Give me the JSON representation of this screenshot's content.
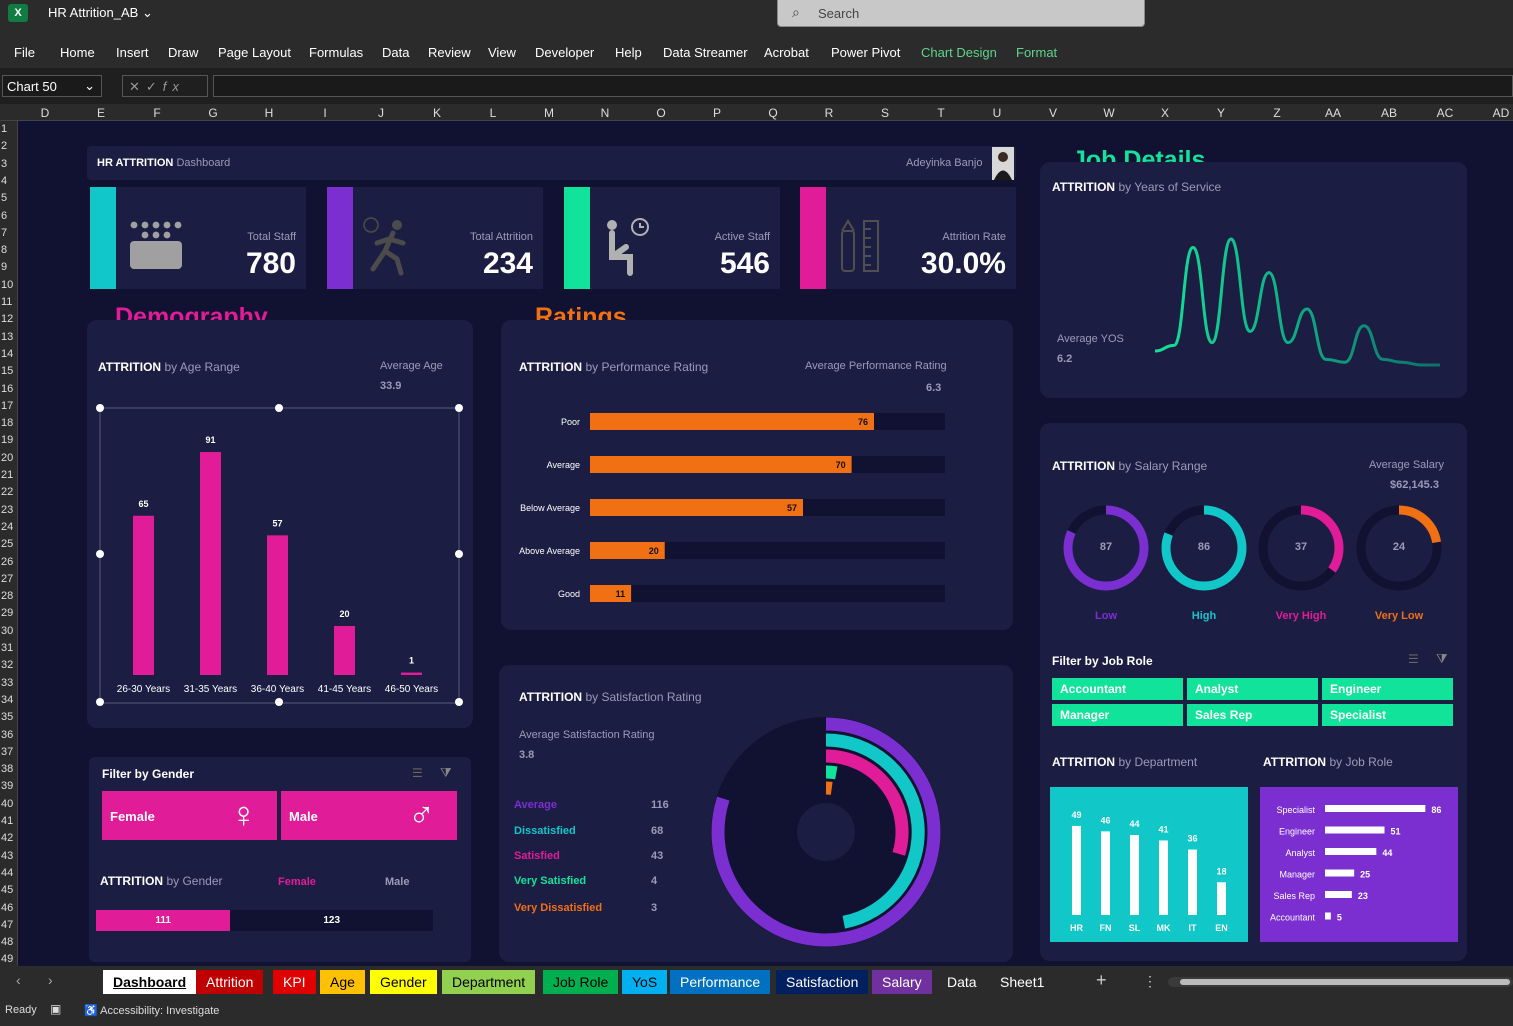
{
  "app": {
    "workbook": "HR Attrition_AB",
    "logo": "X",
    "search_placeholder": "Search",
    "menus": [
      "File",
      "Home",
      "Insert",
      "Draw",
      "Page Layout",
      "Formulas",
      "Data",
      "Review",
      "View",
      "Developer",
      "Help",
      "Data Streamer",
      "Acrobat",
      "Power Pivot",
      "Chart Design",
      "Format"
    ],
    "namebox": "Chart 50",
    "columns": [
      "D",
      "E",
      "F",
      "G",
      "H",
      "I",
      "J",
      "K",
      "L",
      "M",
      "N",
      "O",
      "P",
      "Q",
      "R",
      "S",
      "T",
      "U",
      "V",
      "W",
      "X",
      "Y",
      "Z",
      "AA",
      "AB",
      "AC",
      "AD"
    ],
    "rows": [
      "1",
      "2",
      "3",
      "4",
      "5",
      "6",
      "7",
      "8",
      "9",
      "10",
      "11",
      "12",
      "13",
      "14",
      "15",
      "16",
      "17",
      "18",
      "19",
      "20",
      "21",
      "22",
      "23",
      "24",
      "25",
      "26",
      "27",
      "28",
      "29",
      "30",
      "31",
      "32",
      "33",
      "34",
      "35",
      "36",
      "37",
      "38",
      "39",
      "40",
      "41",
      "42",
      "43",
      "44",
      "45",
      "46",
      "47",
      "48",
      "49"
    ]
  },
  "dashboard": {
    "title": "HR ATTRITION",
    "title_sub": "Dashboard",
    "author": "Adeyinka Banjo",
    "kpis": [
      {
        "label": "Total Staff",
        "value": "780",
        "color": "#11c7c7"
      },
      {
        "label": "Total Attrition",
        "value": "234",
        "color": "#7b2fd0"
      },
      {
        "label": "Active Staff",
        "value": "546",
        "color": "#12e39a"
      },
      {
        "label": "Attrition Rate",
        "value": "30.0%",
        "color": "#e11c98"
      }
    ],
    "sections": {
      "demography": "Demography",
      "ratings": "Ratings",
      "job": "Job Details"
    }
  },
  "age_chart": {
    "heading": "ATTRITION",
    "sub": "by Age Range",
    "avg_label": "Average Age",
    "avg_value": "33.9"
  },
  "perf_chart": {
    "heading": "ATTRITION",
    "sub": "by Performance Rating",
    "avg_label": "Average Performance Rating",
    "avg_value": "6.3"
  },
  "sat_chart": {
    "heading": "ATTRITION",
    "sub": "by Satisfaction Rating",
    "avg_label": "Average Satisfaction Rating",
    "avg_value": "3.8",
    "legend": [
      {
        "label": "Average",
        "value": "116",
        "color": "#7b2fd0"
      },
      {
        "label": "Dissatisfied",
        "value": "68",
        "color": "#11c7c7"
      },
      {
        "label": "Satisfied",
        "value": "43",
        "color": "#e11c98"
      },
      {
        "label": "Very Satisfied",
        "value": "4",
        "color": "#12e39a"
      },
      {
        "label": "Very Dissatisfied",
        "value": "3",
        "color": "#f07013"
      }
    ]
  },
  "yos_chart": {
    "heading": "ATTRITION",
    "sub": "by Years of Service",
    "avg_label": "Average YOS",
    "avg_value": "6.2"
  },
  "salary_chart": {
    "heading": "ATTRITION",
    "sub": "by Salary Range",
    "avg_label": "Average Salary",
    "avg_value": "$62,145.3",
    "rings": [
      {
        "label": "Low",
        "value": "87",
        "color": "#7b2fd0"
      },
      {
        "label": "High",
        "value": "86",
        "color": "#11c7c7"
      },
      {
        "label": "Very High",
        "value": "37",
        "color": "#e11c98"
      },
      {
        "label": "Very Low",
        "value": "24",
        "color": "#f07013"
      }
    ]
  },
  "job_filter": {
    "title": "Filter by Job Role",
    "roles": [
      "Accountant",
      "Analyst",
      "Engineer",
      "Manager",
      "Sales Rep",
      "Specialist"
    ]
  },
  "dept_chart": {
    "heading": "ATTRITION",
    "sub": "by Department"
  },
  "role_chart": {
    "heading": "ATTRITION",
    "sub": "by Job Role"
  },
  "gender_filter": {
    "title": "Filter by Gender",
    "female": "Female",
    "male": "Male"
  },
  "gender_chart": {
    "heading": "ATTRITION",
    "sub": "by Gender",
    "female_label": "Female",
    "male_label": "Male",
    "female_value": "111",
    "male_value": "123"
  },
  "chart_data": [
    {
      "type": "bar",
      "title": "ATTRITION by Age Range",
      "categories": [
        "26-30 Years",
        "31-35 Years",
        "36-40 Years",
        "41-45 Years",
        "46-50 Years"
      ],
      "values": [
        65,
        91,
        57,
        20,
        1
      ],
      "ylim": [
        0,
        100
      ],
      "colors": {
        "bar": "#e11c98"
      }
    },
    {
      "type": "bar",
      "orientation": "horizontal",
      "title": "ATTRITION by Performance Rating",
      "categories": [
        "Poor",
        "Average",
        "Below Average",
        "Above Average",
        "Good"
      ],
      "values": [
        76,
        70,
        57,
        20,
        11
      ],
      "xlim": [
        0,
        95
      ],
      "colors": {
        "bar": "#f07013"
      }
    },
    {
      "type": "pie",
      "title": "ATTRITION by Satisfaction Rating",
      "categories": [
        "Average",
        "Dissatisfied",
        "Satisfied",
        "Very Satisfied",
        "Very Dissatisfied"
      ],
      "values": [
        116,
        68,
        43,
        4,
        3
      ]
    },
    {
      "type": "line",
      "title": "ATTRITION by Years of Service",
      "x": [
        0,
        1,
        2,
        3,
        4,
        5,
        6,
        7,
        8,
        9,
        10,
        11,
        12,
        13,
        14,
        15
      ],
      "y": [
        5,
        7,
        42,
        8,
        45,
        12,
        33,
        8,
        20,
        2,
        1,
        14,
        2,
        1,
        0,
        0
      ]
    },
    {
      "type": "pie",
      "title": "ATTRITION by Salary Range",
      "categories": [
        "Low",
        "High",
        "Very High",
        "Very Low"
      ],
      "values": [
        87,
        86,
        37,
        24
      ]
    },
    {
      "type": "bar",
      "title": "ATTRITION by Department",
      "categories": [
        "HR",
        "FN",
        "SL",
        "MK",
        "IT",
        "EN"
      ],
      "values": [
        49,
        46,
        44,
        41,
        36,
        18
      ],
      "ylim": [
        0,
        55
      ],
      "colors": {
        "bar": "#ffffff",
        "background": "#11c7c7"
      }
    },
    {
      "type": "bar",
      "orientation": "horizontal",
      "title": "ATTRITION by Job Role",
      "categories": [
        "Specialist",
        "Engineer",
        "Analyst",
        "Manager",
        "Sales Rep",
        "Accountant"
      ],
      "values": [
        86,
        51,
        44,
        25,
        23,
        5
      ],
      "xlim": [
        0,
        90
      ],
      "colors": {
        "bar": "#ffffff",
        "background": "#7b2fd0"
      }
    },
    {
      "type": "bar",
      "orientation": "horizontal",
      "title": "ATTRITION by Gender",
      "categories": [
        "Female",
        "Male"
      ],
      "values": [
        111,
        123
      ]
    }
  ],
  "sheets": [
    {
      "name": "Dashboard",
      "color": "#ffffff",
      "text": "#000000"
    },
    {
      "name": "Attrition",
      "color": "#c00000",
      "text": "#ffffff"
    },
    {
      "name": "KPI",
      "color": "#e00000",
      "text": "#ffffff"
    },
    {
      "name": "Age",
      "color": "#ffc000",
      "text": "#000000"
    },
    {
      "name": "Gender",
      "color": "#ffff00",
      "text": "#000000"
    },
    {
      "name": "Department",
      "color": "#92d050",
      "text": "#000000"
    },
    {
      "name": "Job Role",
      "color": "#00b050",
      "text": "#000000"
    },
    {
      "name": "YoS",
      "color": "#00b0f0",
      "text": "#000000"
    },
    {
      "name": "Performance",
      "color": "#0070c0",
      "text": "#ffffff"
    },
    {
      "name": "Satisfaction",
      "color": "#002060",
      "text": "#ffffff"
    },
    {
      "name": "Salary",
      "color": "#7030a0",
      "text": "#ffffff"
    },
    {
      "name": "Data",
      "color": "",
      "text": "#ffffff"
    },
    {
      "name": "Sheet1",
      "color": "",
      "text": "#ffffff"
    }
  ],
  "status": {
    "ready": "Ready",
    "accessibility": "Accessibility: Investigate"
  }
}
